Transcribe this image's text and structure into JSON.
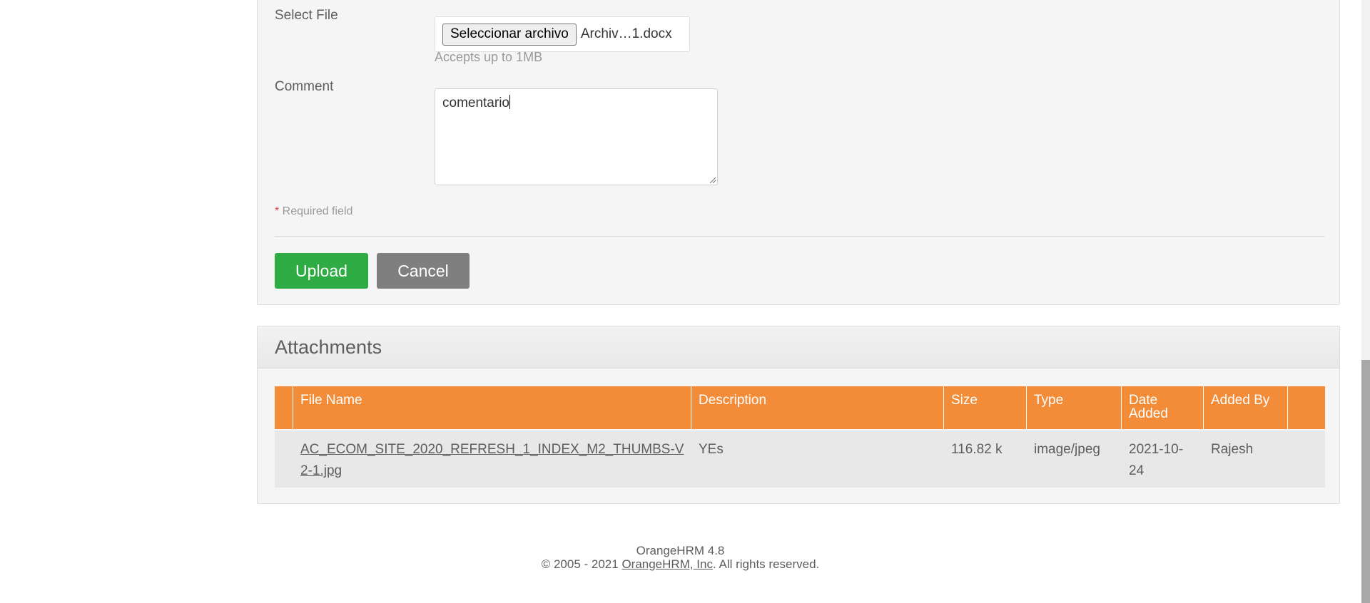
{
  "form": {
    "select_file_label": "Select File",
    "file_button_label": "Seleccionar archivo",
    "selected_file_name": "Archiv…1.docx",
    "file_hint": "Accepts up to 1MB",
    "comment_label": "Comment",
    "comment_value": "comentario",
    "required_star": "*",
    "required_text": " Required field",
    "upload_label": "Upload",
    "cancel_label": "Cancel"
  },
  "attachments": {
    "title": "Attachments",
    "columns": [
      "File Name",
      "Description",
      "Size",
      "Type",
      "Date Added",
      "Added By"
    ],
    "rows": [
      {
        "file_name": "AC_ECOM_SITE_2020_REFRESH_1_INDEX_M2_THUMBS-V2-1.jpg",
        "description": "YEs",
        "size": "116.82 k",
        "type": "image/jpeg",
        "date_added": "2021-10-24",
        "added_by": "Rajesh"
      }
    ]
  },
  "footer": {
    "version": "OrangeHRM 4.8",
    "copyright_prefix": "© 2005 - 2021 ",
    "company_link": "OrangeHRM, Inc",
    "copyright_suffix": ". All rights reserved."
  },
  "colors": {
    "table_header": "#f28c38",
    "upload_button": "#2fab44",
    "cancel_button": "#7f7f7f",
    "required_star": "#e04b4b"
  }
}
